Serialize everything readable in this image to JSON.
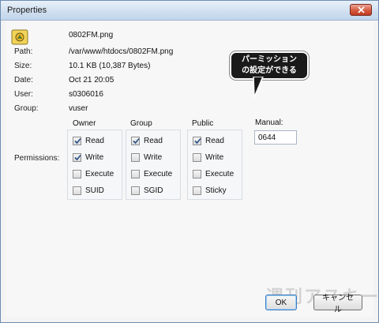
{
  "window": {
    "title": "Properties"
  },
  "file": {
    "name": "0802FM.png",
    "icon": "png-file-icon",
    "path_label": "Path:",
    "path": "/var/www/htdocs/0802FM.png",
    "size_label": "Size:",
    "size": "10.1 KB  (10,387 Bytes)",
    "date_label": "Date:",
    "date": "Oct 21 20:05",
    "user_label": "User:",
    "user": "s0306016",
    "group_label": "Group:",
    "group": "vuser"
  },
  "permissions": {
    "label": "Permissions:",
    "groups": [
      {
        "title": "Owner",
        "options": [
          {
            "label": "Read",
            "checked": true
          },
          {
            "label": "Write",
            "checked": true
          },
          {
            "label": "Execute",
            "checked": false
          },
          {
            "label": "SUID",
            "checked": false
          }
        ]
      },
      {
        "title": "Group",
        "options": [
          {
            "label": "Read",
            "checked": true
          },
          {
            "label": "Write",
            "checked": false
          },
          {
            "label": "Execute",
            "checked": false
          },
          {
            "label": "SGID",
            "checked": false
          }
        ]
      },
      {
        "title": "Public",
        "options": [
          {
            "label": "Read",
            "checked": true
          },
          {
            "label": "Write",
            "checked": false
          },
          {
            "label": "Execute",
            "checked": false
          },
          {
            "label": "Sticky",
            "checked": false
          }
        ]
      }
    ],
    "manual_label": "Manual:",
    "manual_value": "0644"
  },
  "callout": {
    "line1": "パーミッション",
    "line2": "の設定ができる"
  },
  "buttons": {
    "ok": "OK",
    "cancel": "キャンセル"
  },
  "watermark": "週刊アスキー",
  "colors": {
    "titlebar": "#cfdeef",
    "close": "#d45a3f",
    "accent": "#3b7bbf"
  }
}
